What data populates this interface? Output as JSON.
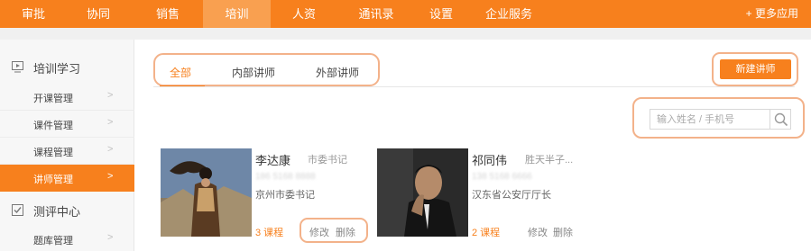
{
  "topnav": {
    "items": [
      "审批",
      "协同",
      "销售",
      "培训",
      "人资",
      "通讯录",
      "设置",
      "企业服务"
    ],
    "active_index": 3,
    "more_label": "+ 更多应用"
  },
  "sidebar": {
    "training_section": {
      "label": "培训学习",
      "icon": "monitor-icon"
    },
    "training_items": [
      {
        "label": "开课管理"
      },
      {
        "label": "课件管理"
      },
      {
        "label": "课程管理"
      },
      {
        "label": "讲师管理"
      }
    ],
    "active_index": 3,
    "evaluation_section": {
      "label": "测评中心",
      "icon": "checkbox-icon"
    },
    "evaluation_items": [
      {
        "label": "题库管理"
      }
    ]
  },
  "tabs": [
    {
      "label": "全部"
    },
    {
      "label": "内部讲师"
    },
    {
      "label": "外部讲师"
    }
  ],
  "active_tab": 0,
  "new_button_label": "新建讲师",
  "search": {
    "placeholder": "输入姓名 / 手机号",
    "icon": "search-icon"
  },
  "lecturers": [
    {
      "name": "李达康",
      "title": "市委书记",
      "phone": "186 5168 8888",
      "org": "京州市委书记",
      "courses": "3 课程",
      "edit_label": "修改",
      "delete_label": "删除"
    },
    {
      "name": "祁同伟",
      "title": "胜天半子...",
      "phone": "138 5168 6666",
      "org": "汉东省公安厅厅长",
      "courses": "2 课程",
      "edit_label": "修改",
      "delete_label": "删除"
    }
  ],
  "colors": {
    "accent": "#f7801d",
    "highlight_outline": "#f3b28a"
  }
}
